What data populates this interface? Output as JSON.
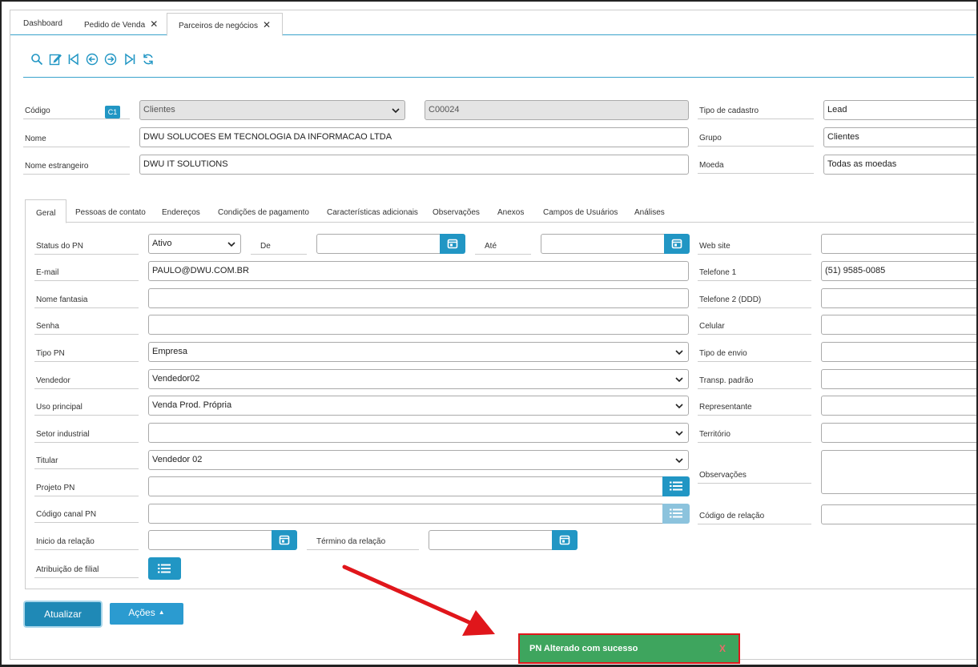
{
  "top_tabs": [
    {
      "label": "Dashboard"
    },
    {
      "label": "Pedido de Venda",
      "close": "✕"
    },
    {
      "label": "Parceiros de negócios",
      "close": "✕"
    }
  ],
  "toolbar": {
    "icons": [
      "search-icon",
      "edit-icon",
      "first-record-icon",
      "previous-record-icon",
      "next-record-icon",
      "last-record-icon",
      "refresh-icon"
    ]
  },
  "header": {
    "codigo_label": "Código",
    "codigo_badge": "C1",
    "codigo_type": "Clientes",
    "codigo_value": "C00024",
    "nome_label": "Nome",
    "nome_value": "DWU SOLUCOES EM TECNOLOGIA DA INFORMACAO LTDA",
    "nome_estrangeiro_label": "Nome estrangeiro",
    "nome_estrangeiro_value": "DWU IT SOLUTIONS",
    "tipo_cadastro_label": "Tipo de cadastro",
    "tipo_cadastro_value": "Lead",
    "grupo_label": "Grupo",
    "grupo_value": "Clientes",
    "moeda_label": "Moeda",
    "moeda_value": "Todas as moedas"
  },
  "inner_tabs": [
    {
      "label": "Geral"
    },
    {
      "label": "Pessoas de contato"
    },
    {
      "label": "Endereços"
    },
    {
      "label": "Condições de pagamento"
    },
    {
      "label": "Características adicionais"
    },
    {
      "label": "Observações"
    },
    {
      "label": "Anexos"
    },
    {
      "label": "Campos de Usuários"
    },
    {
      "label": "Análises"
    }
  ],
  "geral": {
    "status_label": "Status do PN",
    "status_value": "Ativo",
    "de_label": "De",
    "ate_label": "Até",
    "email_label": "E-mail",
    "email_value": "PAULO@DWU.COM.BR",
    "nome_fantasia_label": "Nome fantasia",
    "senha_label": "Senha",
    "tipo_pn_label": "Tipo PN",
    "tipo_pn_value": "Empresa",
    "vendedor_label": "Vendedor",
    "vendedor_value": "Vendedor02",
    "uso_principal_label": "Uso principal",
    "uso_principal_value": "Venda Prod. Própria",
    "setor_label": "Setor industrial",
    "titular_label": "Titular",
    "titular_value": "Vendedor 02",
    "projeto_label": "Projeto PN",
    "canal_label": "Código canal PN",
    "inicio_label": "Inicio da relação",
    "termino_label": "Término da relação",
    "filial_label": "Atribuição de filial",
    "website_label": "Web site",
    "telefone1_label": "Telefone 1",
    "telefone1_value": "(51) 9585-0085",
    "telefone2_label": "Telefone 2 (DDD)",
    "celular_label": "Celular",
    "tipo_envio_label": "Tipo de envio",
    "transp_label": "Transp. padrão",
    "representante_label": "Representante",
    "territorio_label": "Território",
    "observacoes_label": "Observações",
    "codigo_relacao_label": "Código de relação"
  },
  "actions": {
    "update_label": "Atualizar",
    "actions_label": "Ações"
  },
  "toast": {
    "message": "PN Alterado com sucesso",
    "close": "X"
  },
  "colors": {
    "accent": "#2196c4",
    "toast_bg": "#3ea55e",
    "highlight": "#e0161b"
  }
}
